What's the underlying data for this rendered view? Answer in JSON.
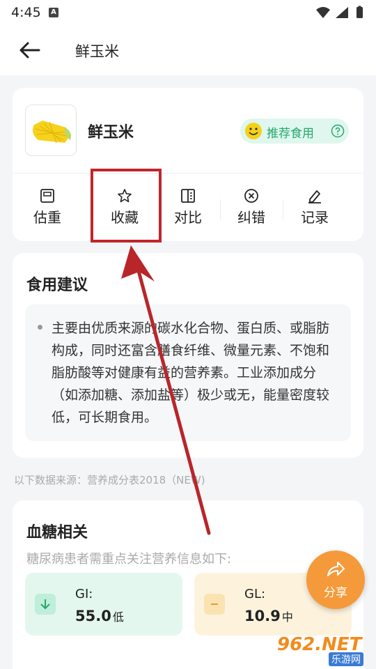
{
  "status_bar": {
    "time": "4:45",
    "notif_letter": "A"
  },
  "app_bar": {
    "title": "鲜玉米"
  },
  "food": {
    "name": "鲜玉米",
    "badge": "推荐食用",
    "actions": [
      {
        "label": "估重",
        "icon": "scale-icon"
      },
      {
        "label": "收藏",
        "icon": "star-icon"
      },
      {
        "label": "对比",
        "icon": "compare-icon"
      },
      {
        "label": "纠错",
        "icon": "error-icon"
      },
      {
        "label": "记录",
        "icon": "edit-icon"
      }
    ]
  },
  "advice": {
    "title": "食用建议",
    "text": "主要由优质来源的碳水化合物、蛋白质、或脂肪构成，同时还富含膳食纤维、微量元素、不饱和脂肪酸等对健康有益的营养素。工业添加成分（如添加糖、添加盐等）极少或无，能量密度较低，可长期食用。"
  },
  "source_note": "以下数据来源：营养成分表2018（NEW)",
  "blood_sugar": {
    "title": "血糖相关",
    "subtitle": "糖尿病患者需重点关注营养信息如下:",
    "gi": {
      "label": "GI:",
      "value": "55.0",
      "level": "低"
    },
    "gl": {
      "label": "GL:",
      "value": "10.9",
      "level": "中"
    }
  },
  "share": {
    "label": "分享"
  },
  "watermark": {
    "logo": "962.NET",
    "sub": "乐游网"
  },
  "colors": {
    "accent_green": "#2aa66f",
    "highlight_red": "#c0262a",
    "share_orange": "#f59a3a"
  }
}
